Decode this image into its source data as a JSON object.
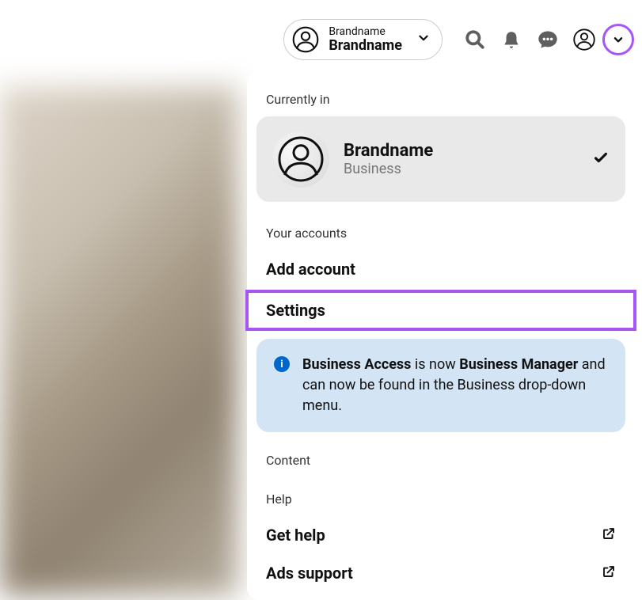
{
  "header": {
    "account_pill": {
      "label_top": "Brandname",
      "label_bottom": "Brandname"
    }
  },
  "dropdown": {
    "currently_in_label": "Currently in",
    "current_account": {
      "name": "Brandname",
      "type": "Business"
    },
    "your_accounts_label": "Your accounts",
    "add_account_label": "Add account",
    "settings_label": "Settings",
    "info_box": {
      "bold1": "Business Access",
      "mid1": " is now ",
      "bold2": "Business Manager",
      "mid2": " and can now be found in the Business drop-down menu."
    },
    "content_label": "Content",
    "help_label": "Help",
    "get_help_label": "Get help",
    "ads_support_label": "Ads support"
  },
  "colors": {
    "highlight_border": "#a855f7",
    "info_bg": "#d3e5f5",
    "info_icon_bg": "#0066cc"
  }
}
